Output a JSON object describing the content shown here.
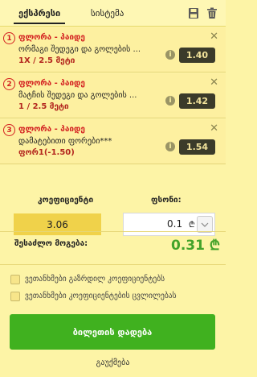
{
  "tabs": [
    {
      "label": "ექსპრესი",
      "active": true
    },
    {
      "label": "სისტემა",
      "active": false
    }
  ],
  "icons": {
    "save": "save-icon",
    "trash": "trash-icon",
    "close": "close-icon",
    "info": "info-icon",
    "chevron": "chevron-down-icon"
  },
  "bets": [
    {
      "index": "1",
      "match": "ფლორა - პაიდე",
      "market": "ორმაგი შედეგი და გოლების ...",
      "pick": "1X / 2.5 მეტი",
      "odd": "1.40"
    },
    {
      "index": "2",
      "match": "ფლორა - პაიდე",
      "market": "მატჩის შედეგი და გოლების ...",
      "pick": "1 / 2.5 მეტი",
      "odd": "1.42"
    },
    {
      "index": "3",
      "match": "ფლორა - პაიდე",
      "market": "დამატებითი ფორები***",
      "pick": "ფორ1(-1.50)",
      "odd": "1.54"
    }
  ],
  "coefficient": {
    "label": "კოეფიციენტი",
    "value": "3.06"
  },
  "stake": {
    "label": "ფსონი:",
    "value": "0.1",
    "currency": "₾"
  },
  "total": {
    "label": "შესაძლო მოგება:",
    "value": "0.31 ₾"
  },
  "checkboxes": [
    {
      "label": "ვეთანხმები გაზრდილ კოეფიციენტებს",
      "checked": false
    },
    {
      "label": "ვეთანხმები კოეფიციენტების ცვლილებას",
      "checked": false
    }
  ],
  "actions": {
    "place_bet": "ბილეთის დადება",
    "cancel": "გაუქმება"
  },
  "colors": {
    "background": "#fdf4a6",
    "accent_red": "#d32020",
    "odd_bg": "#3b3b2a",
    "coef_bg": "#f0d24a",
    "button_green": "#40b11f"
  }
}
